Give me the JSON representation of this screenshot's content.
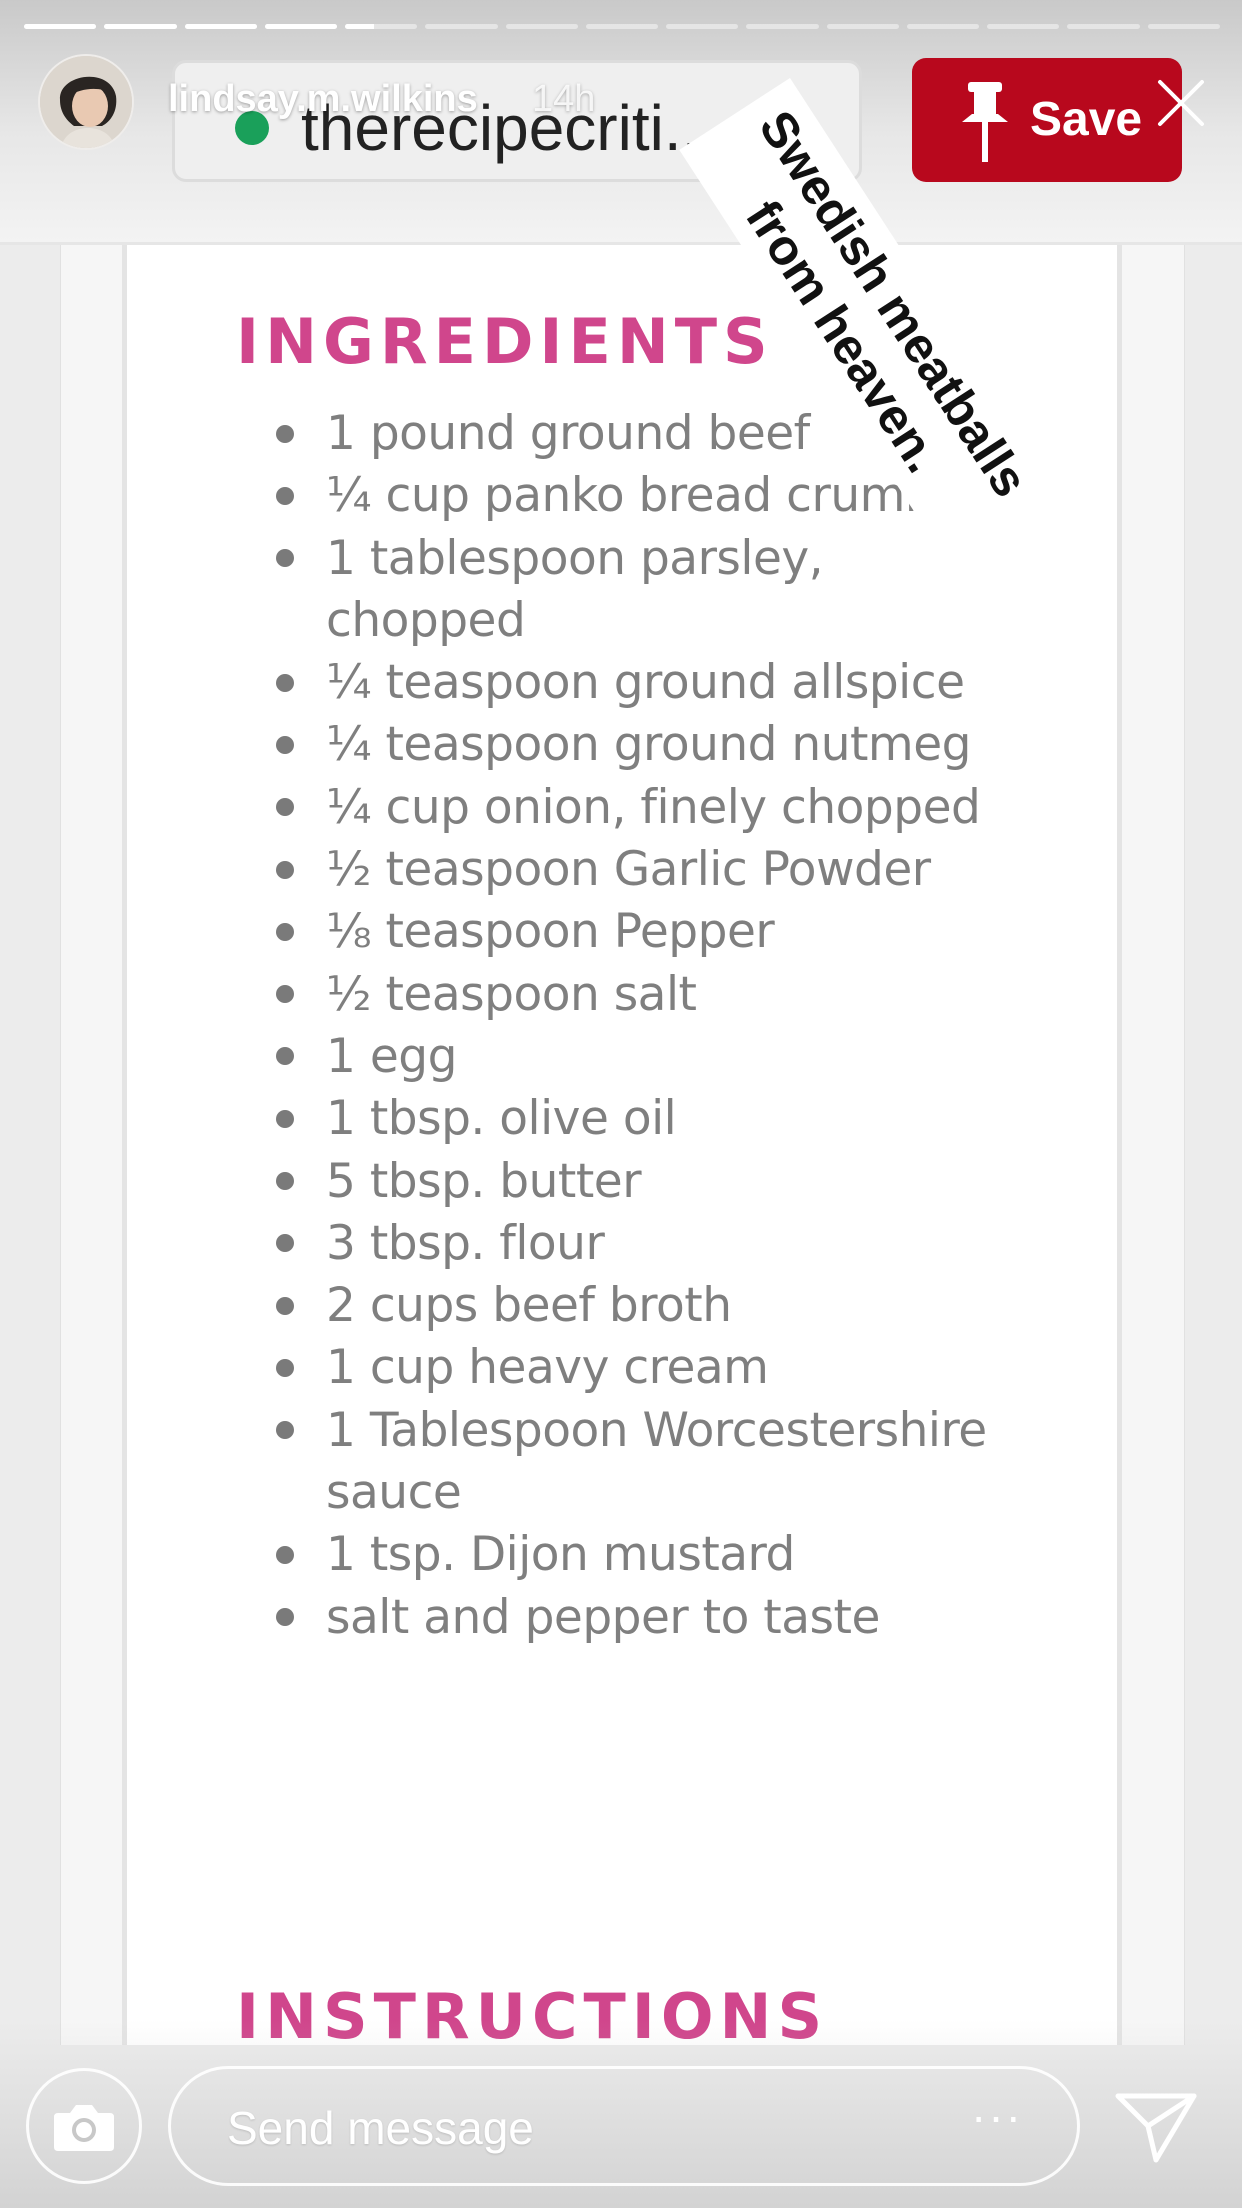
{
  "story": {
    "username": "lindsay.m.wilkins",
    "timestamp": "14h",
    "segments_total": 15,
    "segments_complete": 4,
    "current_segment_progress": 0.4
  },
  "browser": {
    "url": "therecipecriti...",
    "secure_dot_color": "#1aa05a",
    "save_label": "Save",
    "save_color": "#b8081d"
  },
  "recipe": {
    "ingredients_heading": "INGREDIENTS",
    "heading_color": "#d0468c",
    "ingredients": [
      "1 pound ground beef",
      "¼ cup panko bread crumbs",
      "1 tablespoon parsley, chopped",
      "¼ teaspoon ground allspice",
      "¼ teaspoon ground nutmeg",
      "¼ cup onion, finely chopped",
      "½ teaspoon Garlic Powder",
      "⅛ teaspoon Pepper",
      "½ teaspoon salt",
      "1 egg",
      "1 tbsp. olive oil",
      "5 tbsp. butter",
      "3 tbsp. flour",
      "2 cups beef broth",
      "1 cup heavy cream",
      "1 Tablespoon Worcestershire sauce",
      "1 tsp. Dijon mustard",
      "salt and pepper to taste"
    ],
    "instructions_heading": "INSTRUCTIONS"
  },
  "sticker": {
    "line1": "Swedish meatballs",
    "line2": "from heaven."
  },
  "footer": {
    "message_placeholder": "Send message",
    "more_label": "···"
  },
  "icons": {
    "close": "close-icon",
    "camera": "camera-icon",
    "direct": "paper-plane-icon",
    "pin": "pushpin-icon"
  }
}
